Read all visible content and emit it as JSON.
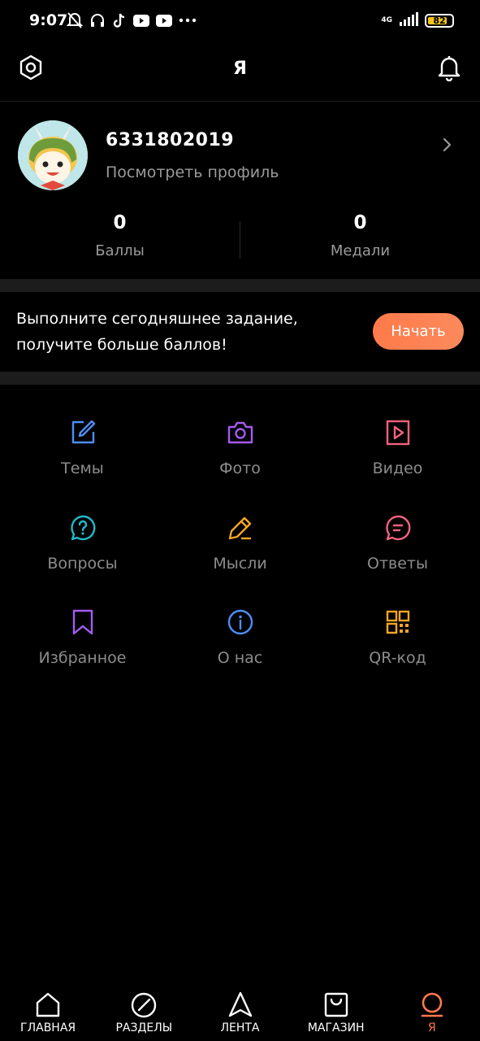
{
  "status_bar": {
    "time": "9:07",
    "network": "4G",
    "battery": "82",
    "battery_level": 0.82,
    "icons": [
      "muted-bell-icon",
      "headphones-icon",
      "tiktok-icon",
      "youtube-icon",
      "youtube-icon",
      "more-dots-icon",
      "signal-icon",
      "battery-icon"
    ]
  },
  "header": {
    "title": "Я",
    "left_icon": "settings-hexagon-icon",
    "right_icon": "bell-icon"
  },
  "profile": {
    "user_id": "6331802019",
    "view_profile": "Посмотреть профиль",
    "stats": [
      {
        "value": "0",
        "label": "Баллы"
      },
      {
        "value": "0",
        "label": "Медали"
      }
    ]
  },
  "task": {
    "line1": "Выполните сегодняшнее задание,",
    "line2": "получите больше баллов!",
    "button": "Начать"
  },
  "grid": [
    {
      "label": "Темы",
      "icon": "edit-icon",
      "color": "#4f8ef7"
    },
    {
      "label": "Фото",
      "icon": "camera-icon",
      "color": "#a45cf0"
    },
    {
      "label": "Видео",
      "icon": "video-icon",
      "color": "#f2627e"
    },
    {
      "label": "Вопросы",
      "icon": "question-icon",
      "color": "#22b8c8"
    },
    {
      "label": "Мысли",
      "icon": "pencil-icon",
      "color": "#f5a623"
    },
    {
      "label": "Ответы",
      "icon": "chat-icon",
      "color": "#f2627e"
    },
    {
      "label": "Избранное",
      "icon": "bookmark-icon",
      "color": "#a45cf0"
    },
    {
      "label": "О нас",
      "icon": "info-icon",
      "color": "#4f8ef7"
    },
    {
      "label": "QR-код",
      "icon": "qr-code-icon",
      "color": "#f5a623"
    }
  ],
  "bottom_nav": [
    {
      "label": "ГЛАВНАЯ",
      "icon": "home-icon",
      "active": false
    },
    {
      "label": "РАЗДЕЛЫ",
      "icon": "sections-icon",
      "active": false
    },
    {
      "label": "ЛЕНТА",
      "icon": "navigation-arrow-icon",
      "active": false
    },
    {
      "label": "МАГАЗИН",
      "icon": "shopping-bag-icon",
      "active": false
    },
    {
      "label": "Я",
      "icon": "profile-circle-icon",
      "active": true
    }
  ],
  "colors": {
    "background": "#000000",
    "accent": "#ff7a4a",
    "muted_text": "#9a9a9a",
    "separator": "#1c1c1c"
  }
}
